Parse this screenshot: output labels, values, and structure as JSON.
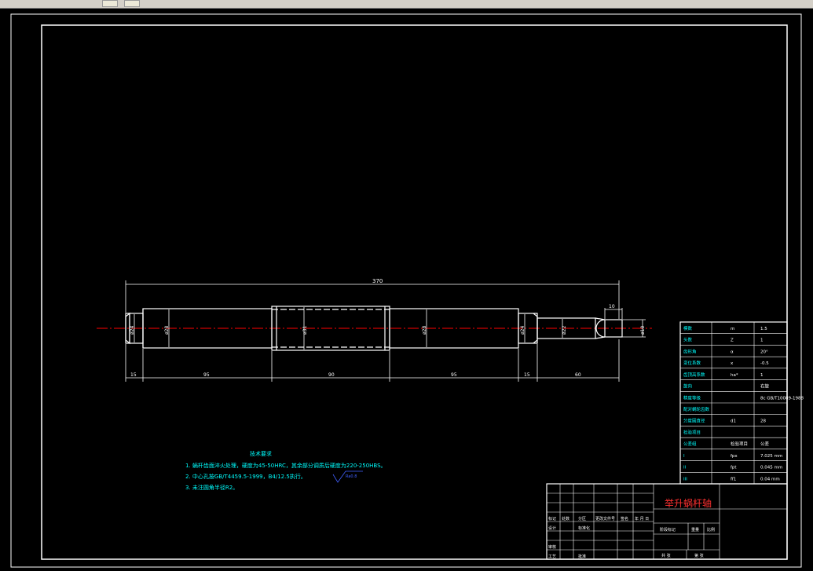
{
  "app": {
    "toolbar_icons": [
      "zoom-icon",
      "view-icon"
    ]
  },
  "colors": {
    "background": "#000000",
    "lines": "#ffffff",
    "dimension": "#ffffff",
    "centerline": "#ff0000",
    "text": "#00ffff",
    "title_accent": "#ff3030",
    "leader": "#4060ff"
  },
  "dimensions": {
    "overall": "370",
    "segments": [
      "15",
      "95",
      "90",
      "95",
      "15",
      "60"
    ],
    "right_top": "10",
    "diameters": [
      "ø24",
      "ø28",
      "ø31",
      "ø28",
      "ø24",
      "ø22",
      "ø10"
    ]
  },
  "tech": {
    "title": "技术要求",
    "lines": [
      "1. 蜗杆齿面淬火处理，硬度为45-50HRC，其余部分调质后硬度为220-250HBS。",
      "2. 中心孔按GB/T4459.5-1999，B4/12.5执行。",
      "3. 未注圆角半径R2。"
    ],
    "roughness": "Ra0.8"
  },
  "params": {
    "rows": [
      [
        "模数",
        "m",
        "1.5"
      ],
      [
        "头数",
        "Z",
        "1"
      ],
      [
        "齿形角",
        "α",
        "20°"
      ],
      [
        "变位系数",
        "x",
        "-0.5"
      ],
      [
        "齿顶高系数",
        "ha*",
        "1"
      ],
      [
        "旋向",
        "",
        "右旋"
      ],
      [
        "精度等级",
        "",
        "8c GB/T10089-1988"
      ],
      [
        "配对蜗轮齿数",
        "",
        ""
      ],
      [
        "分度圆直径",
        "d1",
        "28"
      ],
      [
        "检验项目",
        "",
        ""
      ],
      [
        "公差组",
        "检验项目",
        "公差"
      ],
      [
        "I",
        "fpx",
        "7.025 mm"
      ],
      [
        "II",
        "fpt",
        "0.045 mm"
      ],
      [
        "III",
        "ff1",
        "0.04 mm"
      ]
    ]
  },
  "title_block": {
    "part_name": "举升蜗杆轴",
    "labels": [
      "标记",
      "处数",
      "分区",
      "更改文件号",
      "签名",
      "年 月 日",
      "设计",
      "标准化",
      "审核",
      "工艺",
      "批准",
      "阶段标记",
      "重量",
      "比例",
      "共 张",
      "第 张"
    ]
  }
}
